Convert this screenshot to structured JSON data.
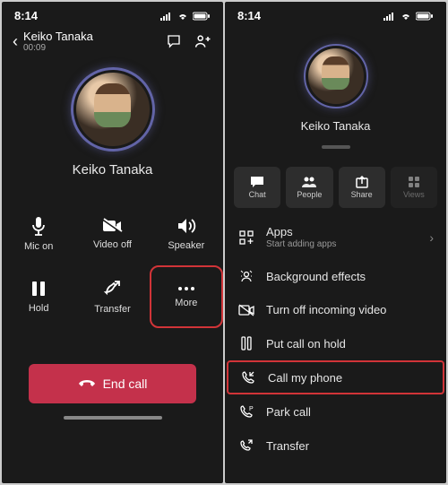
{
  "time": "8:14",
  "left": {
    "header": {
      "name": "Keiko Tanaka",
      "duration": "00:09"
    },
    "person": "Keiko Tanaka",
    "grid": {
      "mic": "Mic on",
      "video": "Video off",
      "speaker": "Speaker",
      "hold": "Hold",
      "transfer": "Transfer",
      "more": "More"
    },
    "endcall": "End call"
  },
  "right": {
    "person": "Keiko Tanaka",
    "top": {
      "chat": "Chat",
      "people": "People",
      "share": "Share",
      "views": "Views"
    },
    "menu": {
      "apps": "Apps",
      "apps_sub": "Start adding apps",
      "bg": "Background effects",
      "incoming": "Turn off incoming video",
      "hold": "Put call on hold",
      "callmyphone": "Call my phone",
      "park": "Park call",
      "transfer": "Transfer"
    }
  }
}
